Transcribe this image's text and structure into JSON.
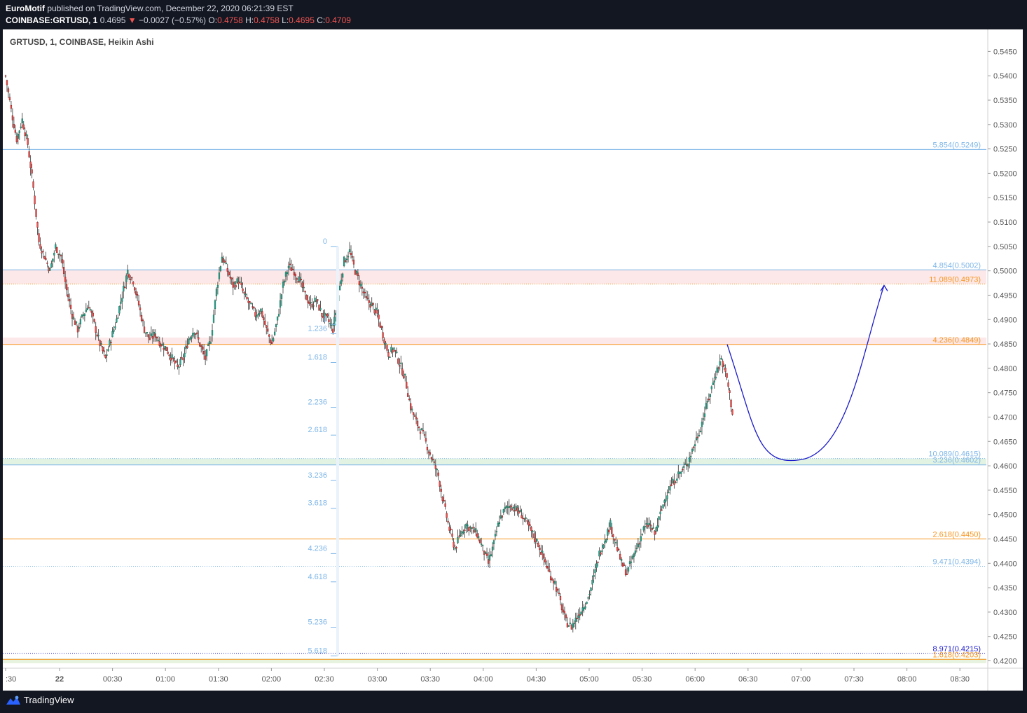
{
  "header": {
    "publisher": "EuroMotif",
    "published_text": "published on TradingView.com, December 22, 2020 06:21:39 EST",
    "symbol": "COINBASE:GRTUSD, 1",
    "last": "0.4695",
    "change_arrow": "▼",
    "change": "−0.0027 (−0.57%)",
    "o_label": "O:",
    "o_value": "0.4758",
    "h_label": "H:",
    "h_value": "0.4758",
    "l_label": "L:",
    "l_value": "0.4695",
    "c_label": "C:",
    "c_value": "0.4709"
  },
  "legend_title": "GRTUSD, 1, COINBASE, Heikin Ashi",
  "footer": {
    "brand": "TradingView",
    "logo_icon": "tradingview-logo-icon"
  },
  "colors": {
    "background": "#131722",
    "plot_bg": "#ffffff",
    "up_candle": "#26a69a",
    "down_candle": "#ef5350",
    "up_candle_dark": "#1e6b4a",
    "down_candle_dark": "#8b1a1a",
    "fib_light_blue": "#7eb6e8",
    "fib_orange": "#f7931a",
    "fib_dark_blue": "#1a1acc",
    "projection": "#1a1acc"
  },
  "chart_data": {
    "type": "candlestick",
    "chart_style": "Heikin Ashi",
    "ylim": [
      0.4195,
      0.5475
    ],
    "y_ticks": [
      "0.4200",
      "0.4250",
      "0.4300",
      "0.4350",
      "0.4400",
      "0.4450",
      "0.4500",
      "0.4550",
      "0.4600",
      "0.4650",
      "0.4700",
      "0.4750",
      "0.4800",
      "0.4850",
      "0.4900",
      "0.4950",
      "0.5000",
      "0.5050",
      "0.5100",
      "0.5150",
      "0.5200",
      "0.5250",
      "0.5300",
      "0.5350",
      "0.5400",
      "0.5450"
    ],
    "x_ticks": [
      ":30",
      "22",
      "00:30",
      "01:00",
      "01:30",
      "02:00",
      "02:30",
      "03:00",
      "03:30",
      "04:00",
      "04:30",
      "05:00",
      "05:30",
      "06:00",
      "06:30",
      "07:00",
      "07:30",
      "08:00",
      "08:30"
    ],
    "price_path": [
      [
        0,
        0.54
      ],
      [
        4,
        0.533
      ],
      [
        8,
        0.527
      ],
      [
        12,
        0.531
      ],
      [
        16,
        0.526
      ],
      [
        20,
        0.517
      ],
      [
        24,
        0.506
      ],
      [
        28,
        0.503
      ],
      [
        32,
        0.5
      ],
      [
        36,
        0.505
      ],
      [
        40,
        0.503
      ],
      [
        44,
        0.496
      ],
      [
        48,
        0.491
      ],
      [
        52,
        0.488
      ],
      [
        56,
        0.491
      ],
      [
        60,
        0.493
      ],
      [
        64,
        0.489
      ],
      [
        68,
        0.485
      ],
      [
        72,
        0.482
      ],
      [
        76,
        0.486
      ],
      [
        80,
        0.49
      ],
      [
        84,
        0.495
      ],
      [
        88,
        0.5
      ],
      [
        92,
        0.498
      ],
      [
        96,
        0.493
      ],
      [
        100,
        0.488
      ],
      [
        104,
        0.486
      ],
      [
        108,
        0.487
      ],
      [
        112,
        0.485
      ],
      [
        116,
        0.484
      ],
      [
        120,
        0.482
      ],
      [
        124,
        0.48
      ],
      [
        128,
        0.482
      ],
      [
        132,
        0.486
      ],
      [
        136,
        0.488
      ],
      [
        140,
        0.485
      ],
      [
        144,
        0.482
      ],
      [
        148,
        0.486
      ],
      [
        152,
        0.496
      ],
      [
        156,
        0.503
      ],
      [
        160,
        0.5
      ],
      [
        164,
        0.497
      ],
      [
        168,
        0.498
      ],
      [
        172,
        0.495
      ],
      [
        176,
        0.493
      ],
      [
        180,
        0.491
      ],
      [
        184,
        0.492
      ],
      [
        188,
        0.488
      ],
      [
        192,
        0.485
      ],
      [
        196,
        0.49
      ],
      [
        200,
        0.497
      ],
      [
        204,
        0.501
      ],
      [
        208,
        0.5
      ],
      [
        212,
        0.498
      ],
      [
        216,
        0.495
      ],
      [
        220,
        0.493
      ],
      [
        224,
        0.494
      ],
      [
        228,
        0.491
      ],
      [
        232,
        0.49
      ],
      [
        236,
        0.488
      ],
      [
        240,
        0.495
      ],
      [
        244,
        0.502
      ],
      [
        248,
        0.504
      ],
      [
        252,
        0.5
      ],
      [
        256,
        0.497
      ],
      [
        260,
        0.494
      ],
      [
        264,
        0.493
      ],
      [
        268,
        0.491
      ],
      [
        272,
        0.487
      ],
      [
        276,
        0.483
      ],
      [
        280,
        0.484
      ],
      [
        284,
        0.481
      ],
      [
        288,
        0.478
      ],
      [
        292,
        0.472
      ],
      [
        296,
        0.469
      ],
      [
        300,
        0.467
      ],
      [
        304,
        0.464
      ],
      [
        308,
        0.461
      ],
      [
        312,
        0.458
      ],
      [
        316,
        0.452
      ],
      [
        320,
        0.447
      ],
      [
        324,
        0.443
      ],
      [
        328,
        0.446
      ],
      [
        332,
        0.448
      ],
      [
        336,
        0.447
      ],
      [
        340,
        0.446
      ],
      [
        344,
        0.443
      ],
      [
        348,
        0.44
      ],
      [
        352,
        0.444
      ],
      [
        356,
        0.449
      ],
      [
        360,
        0.451
      ],
      [
        364,
        0.452
      ],
      [
        368,
        0.451
      ],
      [
        372,
        0.45
      ],
      [
        376,
        0.448
      ],
      [
        380,
        0.446
      ],
      [
        384,
        0.444
      ],
      [
        388,
        0.441
      ],
      [
        392,
        0.438
      ],
      [
        396,
        0.436
      ],
      [
        400,
        0.432
      ],
      [
        404,
        0.428
      ],
      [
        408,
        0.427
      ],
      [
        412,
        0.429
      ],
      [
        416,
        0.431
      ],
      [
        420,
        0.433
      ],
      [
        424,
        0.437
      ],
      [
        428,
        0.442
      ],
      [
        432,
        0.445
      ],
      [
        436,
        0.448
      ],
      [
        440,
        0.444
      ],
      [
        444,
        0.44
      ],
      [
        448,
        0.438
      ],
      [
        452,
        0.441
      ],
      [
        456,
        0.444
      ],
      [
        460,
        0.447
      ],
      [
        464,
        0.448
      ],
      [
        468,
        0.446
      ],
      [
        472,
        0.45
      ],
      [
        476,
        0.454
      ],
      [
        480,
        0.456
      ],
      [
        484,
        0.458
      ],
      [
        488,
        0.459
      ],
      [
        492,
        0.461
      ],
      [
        496,
        0.464
      ],
      [
        500,
        0.467
      ],
      [
        504,
        0.471
      ],
      [
        508,
        0.475
      ],
      [
        512,
        0.479
      ],
      [
        516,
        0.482
      ],
      [
        520,
        0.478
      ],
      [
        524,
        0.471
      ]
    ],
    "fib_levels_left": [
      {
        "label": "0",
        "price": 0.505
      },
      {
        "label": "1",
        "price": 0.489
      },
      {
        "label": "1.236",
        "price": 0.4871
      },
      {
        "label": "1.618",
        "price": 0.4812
      },
      {
        "label": "2.236",
        "price": 0.472
      },
      {
        "label": "2.618",
        "price": 0.4663
      },
      {
        "label": "3.236",
        "price": 0.457
      },
      {
        "label": "3.618",
        "price": 0.4513
      },
      {
        "label": "4.236",
        "price": 0.442
      },
      {
        "label": "4.618",
        "price": 0.4362
      },
      {
        "label": "5.236",
        "price": 0.4269
      },
      {
        "label": "5.618",
        "price": 0.421
      }
    ],
    "fib_levels_right": [
      {
        "label": "5.854(0.5249)",
        "price": 0.5249,
        "color": "light_blue",
        "style": "solid"
      },
      {
        "label": "4.854(0.5002)",
        "price": 0.5002,
        "color": "light_blue",
        "style": "solid"
      },
      {
        "label": "11.089(0.4973)",
        "price": 0.4973,
        "color": "orange",
        "style": "dotted"
      },
      {
        "label": "4.236(0.4849)",
        "price": 0.4849,
        "color": "orange",
        "style": "solid"
      },
      {
        "label": "10.089(0.4615)",
        "price": 0.4615,
        "color": "light_blue",
        "style": "dotted"
      },
      {
        "label": "3.236(0.4602)",
        "price": 0.4602,
        "color": "light_blue",
        "style": "solid"
      },
      {
        "label": "2.618(0.4450)",
        "price": 0.445,
        "color": "orange",
        "style": "solid"
      },
      {
        "label": "9.471(0.4394)",
        "price": 0.4394,
        "color": "light_blue",
        "style": "dotted"
      },
      {
        "label": "8.971(0.4215)",
        "price": 0.4215,
        "color": "dark_blue",
        "style": "dotted"
      },
      {
        "label": "1.618(0.4203)",
        "price": 0.4203,
        "color": "orange",
        "style": "solid"
      }
    ],
    "zones": [
      {
        "from": 0.4973,
        "to": 0.5002,
        "color": "#fce8e8"
      },
      {
        "from": 0.4849,
        "to": 0.4863,
        "color": "#fce8e8"
      },
      {
        "from": 0.4602,
        "to": 0.4615,
        "color": "#e3f3e3"
      },
      {
        "from": 0.4195,
        "to": 0.4205,
        "color": "#e8f3df"
      }
    ],
    "projection_curve": {
      "start": [
        0.4849
      ],
      "bottom": [
        0.4612
      ],
      "end": [
        0.497
      ]
    }
  }
}
